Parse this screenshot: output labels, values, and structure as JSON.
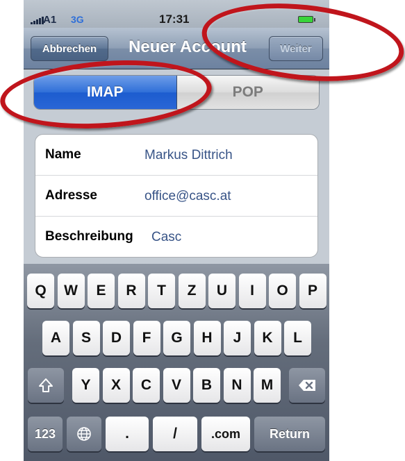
{
  "status_bar": {
    "carrier": "A1",
    "network": "3G",
    "time": "17:31"
  },
  "nav": {
    "cancel_label": "Abbrechen",
    "title": "Neuer Account",
    "next_label": "Weiter"
  },
  "segment": {
    "imap_label": "IMAP",
    "pop_label": "POP",
    "selected": "IMAP"
  },
  "form": {
    "rows": [
      {
        "label": "Name",
        "value": "Markus Dittrich"
      },
      {
        "label": "Adresse",
        "value": "office@casc.at"
      },
      {
        "label": "Beschreibung",
        "value": "Casc"
      }
    ]
  },
  "keyboard": {
    "row1": [
      "Q",
      "W",
      "E",
      "R",
      "T",
      "Z",
      "U",
      "I",
      "O",
      "P"
    ],
    "row2": [
      "A",
      "S",
      "D",
      "F",
      "G",
      "H",
      "J",
      "K",
      "L"
    ],
    "row3": [
      "Y",
      "X",
      "C",
      "V",
      "B",
      "N",
      "M"
    ],
    "shift_icon": "shift-icon",
    "delete_icon": "delete-icon",
    "numbers_label": "123",
    "globe_icon": "globe-icon",
    "dot_label": ".",
    "slash_label": "/",
    "com_label": ".com",
    "return_label": "Return"
  },
  "annotations": {
    "color": "#c0151c"
  }
}
